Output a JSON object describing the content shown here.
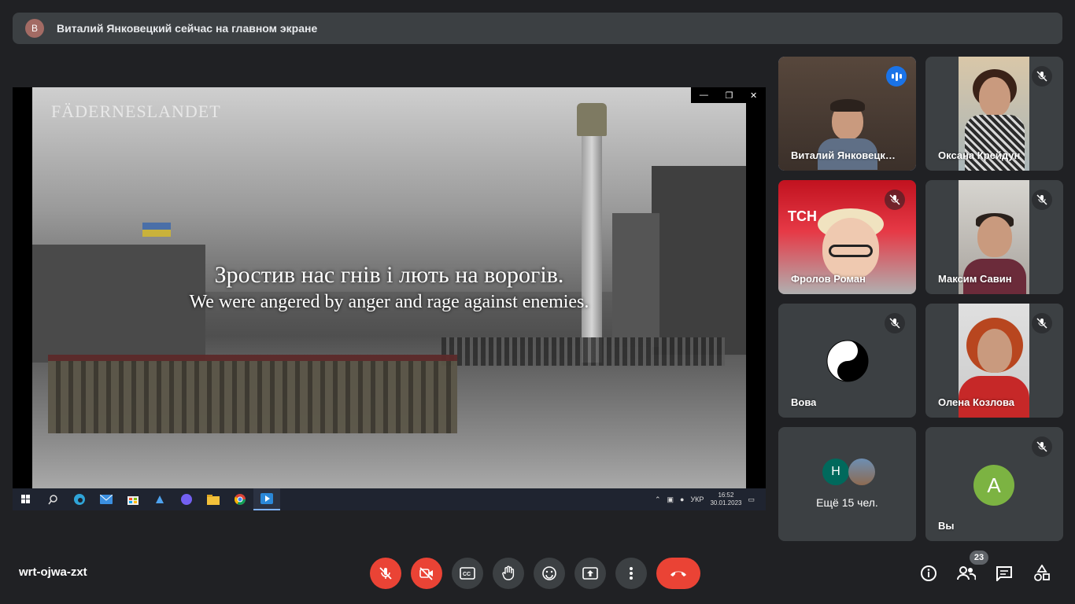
{
  "banner": {
    "avatar_letter": "В",
    "text": "Виталий Янковецкий сейчас на главном экране"
  },
  "presentation": {
    "logo": "FÄDERNESLANDET",
    "subtitle_ua": "Зростив нас гнів і лють на ворогів.",
    "subtitle_en": "We were angered by anger and rage against enemies.",
    "window_controls": [
      "—",
      "❐",
      "✕"
    ]
  },
  "taskbar": {
    "language": "УКР",
    "time": "16:52",
    "date": "30.01.2023"
  },
  "participants": [
    {
      "name": "Виталий Янковецк…",
      "status": "speaking"
    },
    {
      "name": "Оксана Крейдун",
      "status": "muted"
    },
    {
      "name": "Фролов Роман",
      "status": "muted",
      "overlay_text": "ТСН"
    },
    {
      "name": "Максим Савин",
      "status": "muted"
    },
    {
      "name": "Вова",
      "status": "muted",
      "avatar": "yin-yang-icon"
    },
    {
      "name": "Олена Козлова",
      "status": "muted"
    },
    {
      "name": "Вы",
      "status": "muted",
      "avatar_letter": "A",
      "avatar_color": "#7cb342"
    }
  ],
  "more_tile": {
    "label": "Ещё 15 чел.",
    "avatar_letter": "Н",
    "avatar_color": "#00695c"
  },
  "controls": {
    "meeting_code": "wrt-ojwa-zxt",
    "participant_count": "23"
  },
  "colors": {
    "accent": "#8ab4f8",
    "danger": "#ea4335",
    "surface": "#3c4043",
    "background": "#202124"
  }
}
